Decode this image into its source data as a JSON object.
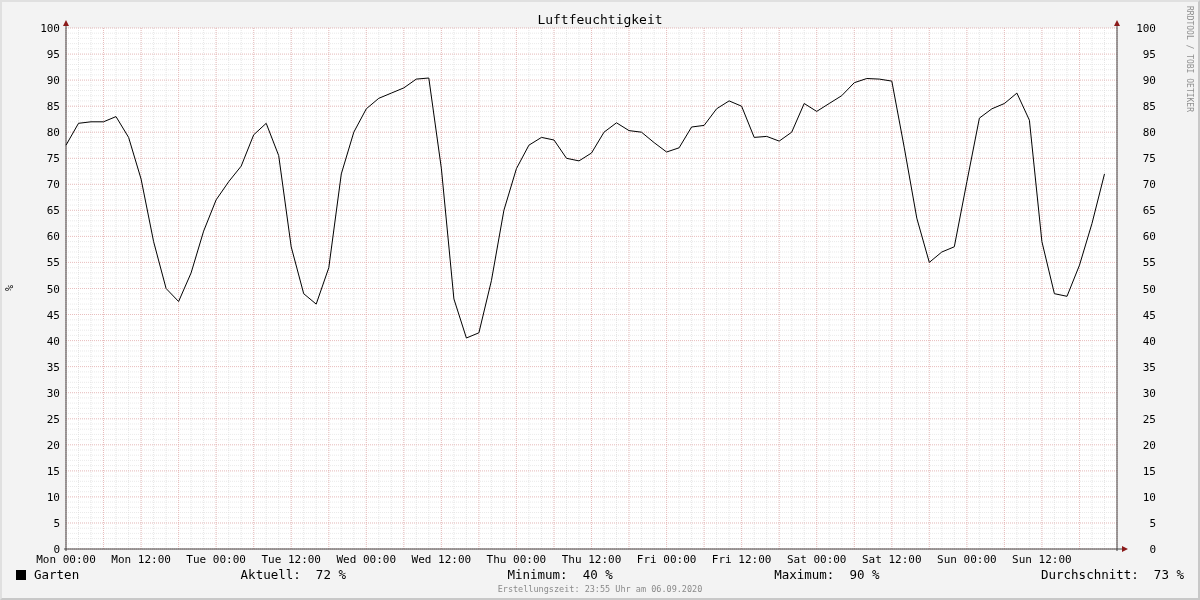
{
  "chart": {
    "watermark": "RRDTOOL / TOBI OETIKER",
    "right_axis_labels": [
      "100",
      "95",
      "90",
      "85",
      "80",
      "75",
      "70",
      "65",
      "60",
      "55",
      "50",
      "45",
      "40",
      "35",
      "30",
      "25",
      "20",
      "15",
      "10",
      "5",
      "0"
    ],
    "chart_data": {
      "type": "line",
      "title": "Luftfeuchtigkeit",
      "ylabel": "%",
      "ylim": [
        0,
        100
      ],
      "grid": true,
      "categories": [
        "Mon 00:00",
        null,
        null,
        null,
        null,
        null,
        "Mon 12:00",
        null,
        null,
        null,
        null,
        null,
        "Tue 00:00",
        null,
        null,
        null,
        null,
        null,
        "Tue 12:00",
        null,
        null,
        null,
        null,
        null,
        "Wed 00:00",
        null,
        null,
        null,
        null,
        null,
        "Wed 12:00",
        null,
        null,
        null,
        null,
        null,
        "Thu 00:00",
        null,
        null,
        null,
        null,
        null,
        "Thu 12:00",
        null,
        null,
        null,
        null,
        null,
        "Fri 00:00",
        null,
        null,
        null,
        null,
        null,
        "Fri 12:00",
        null,
        null,
        null,
        null,
        null,
        "Sat 00:00",
        null,
        null,
        null,
        null,
        null,
        "Sat 12:00",
        null,
        null,
        null,
        null,
        null,
        "Sun 00:00",
        null,
        null,
        null,
        null,
        null,
        "Sun 12:00",
        null,
        null,
        null,
        null,
        null
      ],
      "yticks": [
        0,
        5,
        10,
        15,
        20,
        25,
        30,
        35,
        40,
        45,
        50,
        55,
        60,
        65,
        70,
        75,
        80,
        85,
        90,
        95,
        100
      ],
      "series": [
        {
          "name": "Garten",
          "color": "#000000",
          "values": [
            77.5,
            81.7,
            82,
            82,
            83,
            79,
            71,
            59,
            50,
            47.5,
            53,
            61,
            67,
            70.5,
            73.5,
            79.5,
            81.7,
            75.5,
            58,
            49,
            47,
            54,
            72,
            80,
            84.5,
            86.5,
            87.5,
            88.5,
            90.2,
            90.4,
            73,
            48,
            40.5,
            41.5,
            51.5,
            65,
            73,
            77.5,
            79,
            78.5,
            75,
            74.5,
            76,
            80,
            81.8,
            80.3,
            80,
            78,
            76.2,
            77,
            81,
            81.3,
            84.5,
            86,
            85,
            79,
            79.2,
            78.3,
            80,
            85.5,
            84,
            85.5,
            87,
            89.5,
            90.3,
            90.2,
            89.8,
            77,
            63.5,
            55,
            57,
            58,
            70.5,
            82.7,
            84.5,
            85.5,
            87.5,
            82.3,
            59,
            49,
            48.5,
            54.5,
            62.5,
            72
          ]
        }
      ]
    }
  },
  "legend": {
    "stats": [
      {
        "label": "Aktuell:",
        "value": "72 %"
      },
      {
        "label": "Minimum:",
        "value": "40 %"
      },
      {
        "label": "Maximum:",
        "value": "90 %"
      },
      {
        "label": "Durchschnitt:",
        "value": "73 %"
      }
    ]
  },
  "footer": "Erstellungszeit: 23:55 Uhr am 06.09.2020"
}
